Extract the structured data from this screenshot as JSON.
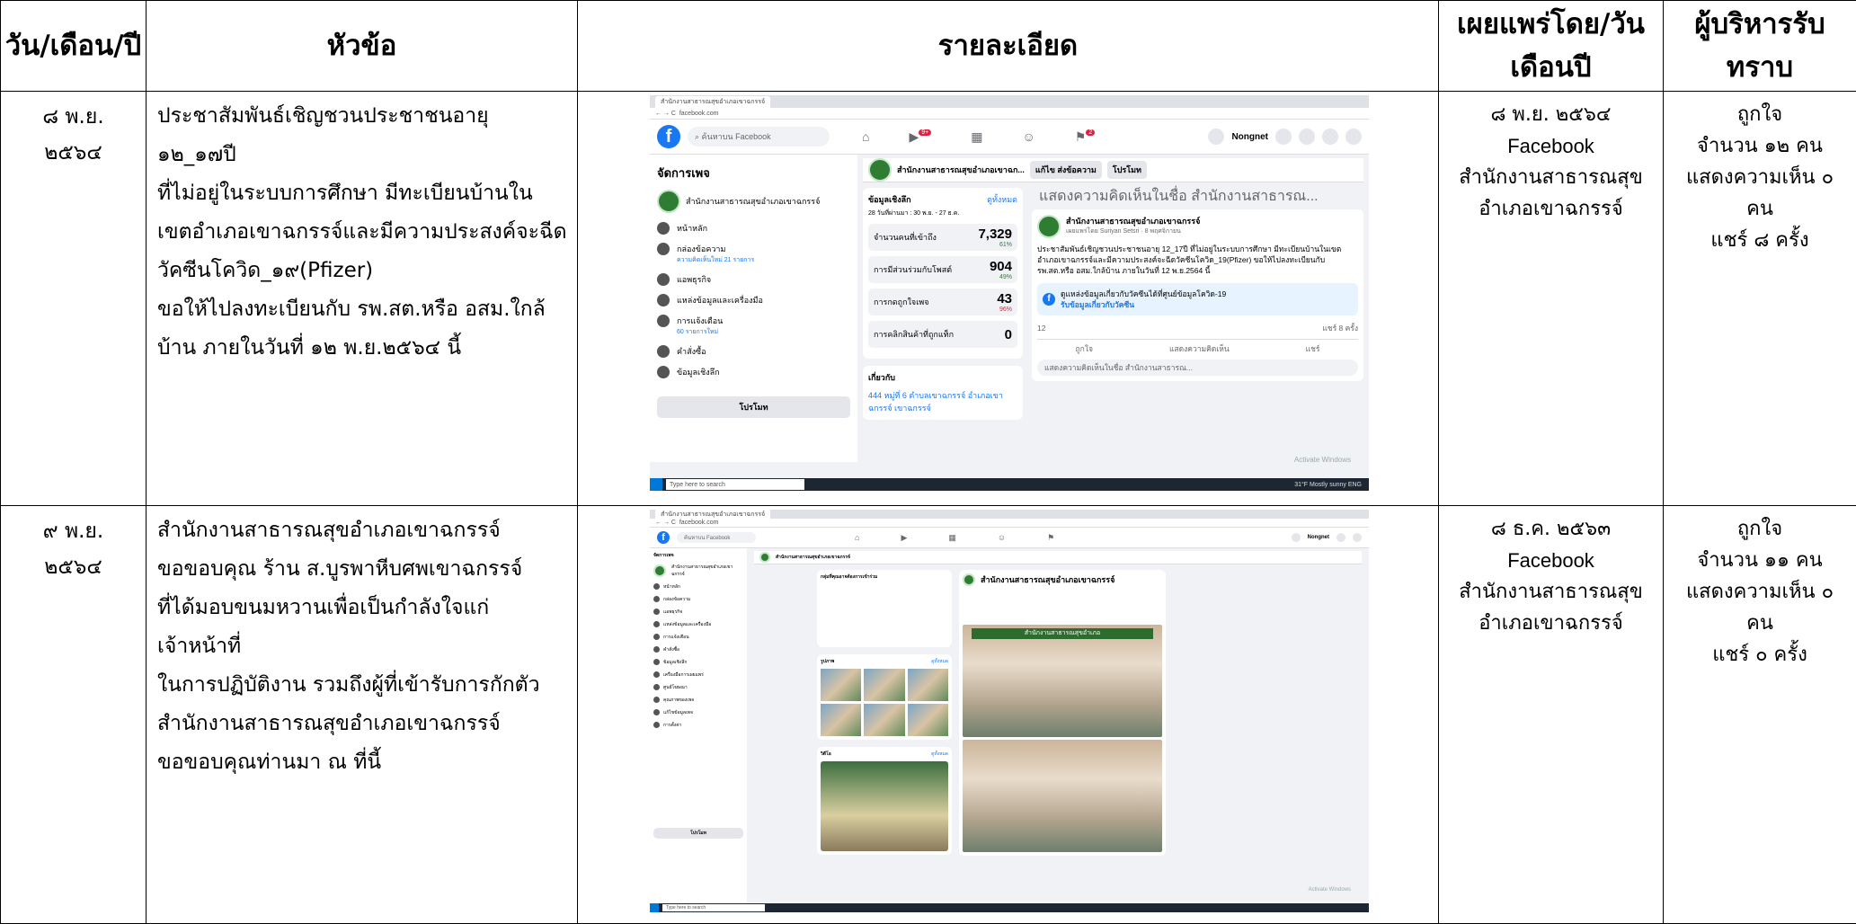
{
  "headers": {
    "date": "วัน/เดือน/ปี",
    "topic": "หัวข้อ",
    "details": "รายละเอียด",
    "published_by": "เผยแพร่โดย/วันเดือนปี",
    "manager": "ผู้บริหารรับทราบ"
  },
  "rows": [
    {
      "date_line1": "๘ พ.ย.",
      "date_line2": "๒๕๖๔",
      "topic_lines": [
        "ประชาสัมพันธ์เชิญชวนประชาชนอายุ ๑๒_๑๗ปี",
        "ที่ไม่อยู่ในระบบการศึกษา มีทะเบียนบ้านใน",
        "เขตอำเภอเขาฉกรรจ์และมีความประสงค์จะฉีด",
        "วัคซีนโควิด_๑๙(Pfizer)",
        "ขอให้ไปลงทะเบียนกับ รพ.สต.หรือ อสม.ใกล้",
        "บ้าน ภายในวันที่ ๑๒ พ.ย.๒๕๖๔ นี้"
      ],
      "pub_date": "๘ พ.ย. ๒๕๖๔",
      "pub_channel": "Facebook",
      "pub_org_line1": "สำนักงานสาธารณสุข",
      "pub_org_line2": "อำเภอเขาฉกรรจ์",
      "mgr_likes": "ถูกใจ",
      "mgr_like_count": "จำนวน ๑๒ คน",
      "mgr_comments_line1": "แสดงความเห็น ๐",
      "mgr_comments_line2": "คน",
      "mgr_shares": "แชร์ ๘ ครั้ง"
    },
    {
      "date_line1": "๙ พ.ย.",
      "date_line2": "๒๕๖๔",
      "topic_lines": [
        "สำนักงานสาธารณสุขอำเภอเขาฉกรรจ์",
        "ขอขอบคุณ ร้าน ส.บูรพาหีบศพเขาฉกรรจ์",
        "ที่ได้มอบขนมหวานเพื่อเป็นกำลังใจแก่",
        "เจ้าหน้าที่",
        "ในการปฏิบัติงาน รวมถึงผู้ที่เข้ารับการกักตัว",
        "สำนักงานสาธารณสุขอำเภอเขาฉกรรจ์",
        "ขอขอบคุณท่านมา ณ ที่นี้"
      ],
      "pub_date": "๘ ธ.ค. ๒๕๖๓",
      "pub_channel": "Facebook",
      "pub_org_line1": "สำนักงานสาธารณสุข",
      "pub_org_line2": "อำเภอเขาฉกรรจ์",
      "mgr_likes": "ถูกใจ",
      "mgr_like_count": "จำนวน ๑๑ คน",
      "mgr_comments_line1": "แสดงความเห็น ๐",
      "mgr_comments_line2": "คน",
      "mgr_shares": "แชร์ ๐ ครั้ง"
    }
  ],
  "shot1": {
    "search_placeholder": "ค้นหาบน Facebook",
    "user_name": "Nongnet",
    "nav_badge": "9+",
    "nav_badge2": "2",
    "manage_title": "จัดการเพจ",
    "page_name": "สำนักงานสาธารณสุขอำเภอเขาฉกรรจ์",
    "page_name_short": "สำนักงานสาธารณสุขอำเภอเขาฉก...",
    "edit_button": "แก้ไข ส่งข้อความ",
    "promote_button": "โปรโมท",
    "nav_items": [
      {
        "label": "หน้าหลัก",
        "sub": ""
      },
      {
        "label": "กล่องข้อความ",
        "sub": "ความคิดเห็นใหม่ 21 รายการ"
      },
      {
        "label": "แอพธุรกิจ",
        "sub": ""
      },
      {
        "label": "แหล่งข้อมูลและเครื่องมือ",
        "sub": ""
      },
      {
        "label": "การแจ้งเตือน",
        "sub": "60 รายการใหม่"
      },
      {
        "label": "คำสั่งซื้อ",
        "sub": ""
      },
      {
        "label": "ข้อมูลเชิงลึก",
        "sub": ""
      }
    ],
    "insights_title": "ข้อมูลเชิงลึก",
    "insights_link": "ดูทั้งหมด",
    "insights_range": "28 วันที่ผ่านมา : 30 พ.ย. - 27 ธ.ค.",
    "stats": [
      {
        "label": "จำนวนคนที่เข้าถึง",
        "value": "7,329",
        "change": "61%",
        "dir": "up"
      },
      {
        "label": "การมีส่วนร่วมกับโพสต์",
        "value": "904",
        "change": "49%",
        "dir": "up"
      },
      {
        "label": "การกดถูกใจเพจ",
        "value": "43",
        "change": "96%",
        "dir": "down"
      },
      {
        "label": "การคลิกสินค้าที่ถูกแท็ก",
        "value": "0",
        "change": "",
        "dir": ""
      }
    ],
    "about_title": "เกี่ยวกับ",
    "address": "444 หมู่ที่ 6 ตำบลเขาฉกรรจ์ อำเภอเขาฉกรรจ์ เขาฉกรรจ์",
    "comment_placeholder": "แสดงความคิดเห็นในชื่อ สำนักงานสาธารณ...",
    "post_author": "สำนักงานสาธารณสุขอำเภอเขาฉกรรจ์",
    "post_meta": "เผยแพร่โดย Suriyan Setsri · 8 พฤศจิกายน",
    "post_text": "ประชาสัมพันธ์เชิญชวนประชาชนอายุ 12_17ปี ที่ไม่อยู่ในระบบการศึกษา มีทะเบียนบ้านในเขตอำเภอเขาฉกรรจ์และมีความประสงค์จะฉีดวัคซีนโควิด_19(Pfizer) ขอให้ไปลงทะเบียนกับ รพ.สต.หรือ อสม.ใกล้บ้าน ภายในวันที่ 12 พ.ย.2564 นี้",
    "covid_info": "ดูแหล่งข้อมูลเกี่ยวกับวัคซีนได้ที่ศูนย์ข้อมูลโควิด-19",
    "covid_link": "รับข้อมูลเกี่ยวกับวัคซีน",
    "reaction_count": "12",
    "share_count": "แชร์ 8 ครั้ง",
    "action_like": "ถูกใจ",
    "action_comment": "แสดงความคิดเห็น",
    "action_share": "แชร์",
    "watermark": "Activate Windows",
    "taskbar_search": "Type here to search",
    "taskbar_tray": "31°F Mostly sunny  ENG"
  },
  "shot2": {
    "search_placeholder": "ค้นหาบน Facebook",
    "user_name": "Nongnet",
    "manage_title": "จัดการเพจ",
    "page_name": "สำนักงานสาธารณสุขอำเภอเขาฉกรรจ์",
    "nav_items": [
      "หน้าหลัก",
      "กล่องข้อความ",
      "แอพธุรกิจ",
      "แหล่งข้อมูลและเครื่องมือ",
      "การแจ้งเตือน",
      "คำสั่งซื้อ",
      "ข้อมูลเชิงลึก",
      "เครื่องมือการเผยแพร่",
      "ศูนย์โฆษณา",
      "คุณภาพของเพจ",
      "แก้ไขข้อมูลเพจ",
      "การตั้งค่า"
    ],
    "promote": "โปรโมท",
    "people_title": "กลุ่มที่คุณอาจต้องการเข้าร่วม",
    "photos_title": "รูปภาพ",
    "videos_title": "วิดีโอ",
    "see_all": "ดูทั้งหมด",
    "post_author": "สำนักงานสาธารณสุขอำเภอเขาฉกรรจ์",
    "banner_text": "สำนักงานสาธารณสุขอำเภอ",
    "watermark": "Activate Windows",
    "taskbar_search": "Type here to search"
  }
}
